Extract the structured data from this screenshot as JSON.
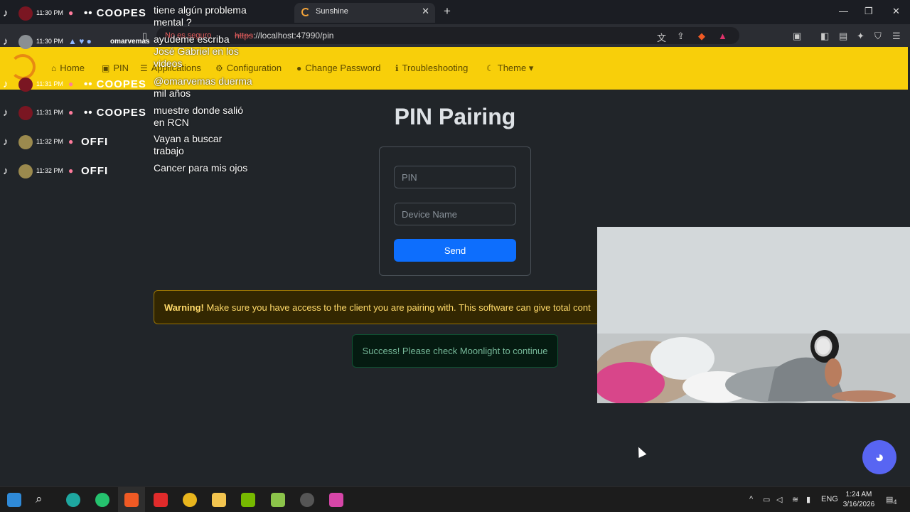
{
  "browser": {
    "tab_title": "Sunshine",
    "tab_close": "✕",
    "new_tab": "+",
    "url_warning": "No es seguro",
    "url_protocol": "https",
    "url_rest": "://localhost:47990/pin",
    "window_controls": [
      "—",
      "❐",
      "✕"
    ]
  },
  "nav": {
    "items": [
      {
        "label": "Home",
        "icon": "home-icon",
        "glyph": "⌂"
      },
      {
        "label": "PIN",
        "icon": "lock-icon",
        "glyph": "🔒"
      },
      {
        "label": "Applications",
        "icon": "list-icon",
        "glyph": "☰"
      },
      {
        "label": "Configuration",
        "icon": "gear-icon",
        "glyph": "⚙"
      },
      {
        "label": "Change Password",
        "icon": "user-lock-icon",
        "glyph": "👤"
      },
      {
        "label": "Troubleshooting",
        "icon": "info-icon",
        "glyph": "ℹ"
      },
      {
        "label": "Theme",
        "icon": "moon-icon",
        "glyph": "☾",
        "caret": "▾"
      }
    ]
  },
  "main": {
    "title": "PIN Pairing",
    "pin_placeholder": "PIN",
    "device_placeholder": "Device Name",
    "send_label": "Send",
    "warning_bold": "Warning!",
    "warning_text": " Make sure you have access to the client you are pairing with. This software can give total cont",
    "success_text": "Success! Please check Moonlight to continue"
  },
  "chat": [
    {
      "time": "11:30 PM",
      "user": "COOPES",
      "msg": "tiene algún problema mental ?"
    },
    {
      "time": "11:30 PM",
      "user": "omarvemas",
      "msg": "ayudeme escriba José Gabriel en los videos"
    },
    {
      "time": "11:31 PM",
      "user": "COOPES",
      "msg": "@omarvemas duerma mil años"
    },
    {
      "time": "11:31 PM",
      "user": "COOPES",
      "msg": "muestre donde salió en RCN"
    },
    {
      "time": "11:32 PM",
      "user": "OFFI",
      "msg": "Vayan a buscar trabajo"
    },
    {
      "time": "11:32 PM",
      "user": "OFFI",
      "msg": "Cancer para mis ojos"
    }
  ],
  "taskbar": {
    "lang": "ENG",
    "time": "1:24 AM",
    "date": "3/16/2026",
    "notif_count": "4"
  },
  "colors": {
    "navbar": "#f8cf0a",
    "primary": "#0d6efd",
    "warning_bg": "#332701",
    "success_bg": "#051b11",
    "discord": "#5865f2"
  }
}
